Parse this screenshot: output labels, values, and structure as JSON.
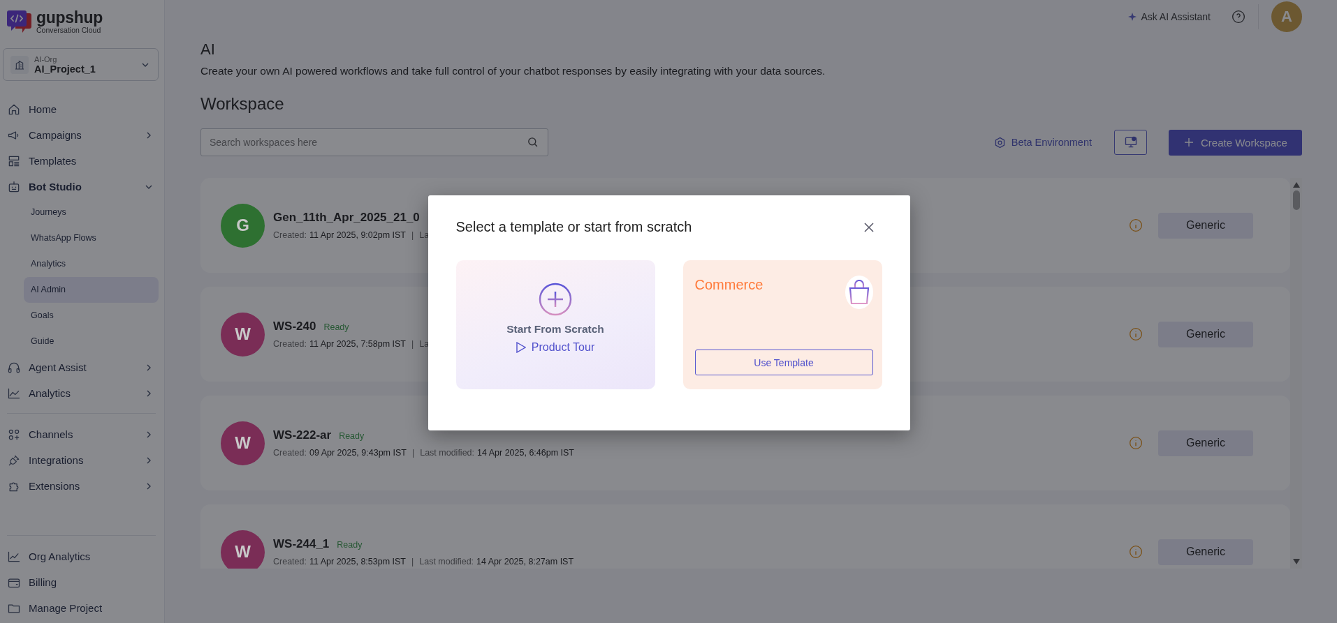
{
  "sidebar": {
    "logo": {
      "name": "gupshup",
      "tagline": "Conversation Cloud"
    },
    "org": {
      "label": "AI-Org",
      "project": "AI_Project_1"
    },
    "sections": [
      {
        "items": [
          {
            "kind": "link",
            "label": "Home"
          },
          {
            "kind": "menu",
            "label": "Campaigns",
            "expanded": false
          },
          {
            "kind": "link",
            "label": "Templates"
          },
          {
            "kind": "menu",
            "label": "Bot Studio",
            "expanded": true,
            "children": [
              {
                "label": "Journeys",
                "selected": false
              },
              {
                "label": "WhatsApp Flows",
                "selected": false
              },
              {
                "label": "Analytics",
                "selected": false
              },
              {
                "label": "AI Admin",
                "selected": true
              },
              {
                "label": "Goals",
                "selected": false
              },
              {
                "label": "Guide",
                "selected": false
              }
            ]
          },
          {
            "kind": "menu",
            "label": "Agent Assist",
            "expanded": false
          },
          {
            "kind": "menu",
            "label": "Analytics",
            "expanded": false
          }
        ]
      },
      {
        "items": [
          {
            "kind": "menu",
            "label": "Channels",
            "expanded": false
          },
          {
            "kind": "menu",
            "label": "Integrations",
            "expanded": false
          },
          {
            "kind": "menu",
            "label": "Extensions",
            "expanded": false
          }
        ]
      },
      {
        "items": [
          {
            "kind": "link",
            "label": "Org Analytics"
          },
          {
            "kind": "link",
            "label": "Billing"
          },
          {
            "kind": "link",
            "label": "Manage Project"
          }
        ]
      }
    ]
  },
  "header": {
    "assistant": "Ask AI Assistant",
    "avatar": "A"
  },
  "page": {
    "title": "AI",
    "description": "Create your own AI powered workflows and take full control of your chatbot responses by easily integrating with your data sources.",
    "section": "Workspace",
    "search": {
      "placeholder": "Search workspaces here"
    },
    "beta": "Beta Environment",
    "create": "Create Workspace"
  },
  "workspaces": [
    {
      "initial": "G",
      "color": "#2e7031",
      "name": "Gen_11th_Apr_2025_21_0",
      "created_label": "Created:",
      "created": "11 Apr 2025, 9:02pm IST",
      "separator": "|",
      "modified_label": "La",
      "tag": "Generic"
    },
    {
      "initial": "W",
      "color": "#7a2d56",
      "name": "WS-240",
      "status": "Ready",
      "created_label": "Created:",
      "created": "11 Apr 2025, 7:58pm IST",
      "separator": "|",
      "modified_label": "La",
      "tag": "Generic"
    },
    {
      "initial": "W",
      "color": "#7a2d56",
      "name": "WS-222-ar",
      "status": "Ready",
      "created_label": "Created:",
      "created": "09 Apr 2025, 9:43pm IST",
      "separator": "|",
      "modified_label": "Last modified:",
      "modified": "14 Apr 2025, 6:46pm IST",
      "tag": "Generic"
    },
    {
      "initial": "W",
      "color": "#7a2d56",
      "name": "WS-244_1",
      "status": "Ready",
      "created_label": "Created:",
      "created": "11 Apr 2025, 8:53pm IST",
      "separator": "|",
      "modified_label": "Last modified:",
      "modified": "14 Apr 2025, 8:27am IST",
      "tag": "Generic"
    }
  ],
  "modal": {
    "title": "Select a template or start from scratch",
    "options": [
      {
        "kind": "scratch",
        "title": "Start From Scratch",
        "link": "Product Tour"
      },
      {
        "kind": "template",
        "title": "Commerce",
        "button": "Use Template"
      }
    ]
  }
}
